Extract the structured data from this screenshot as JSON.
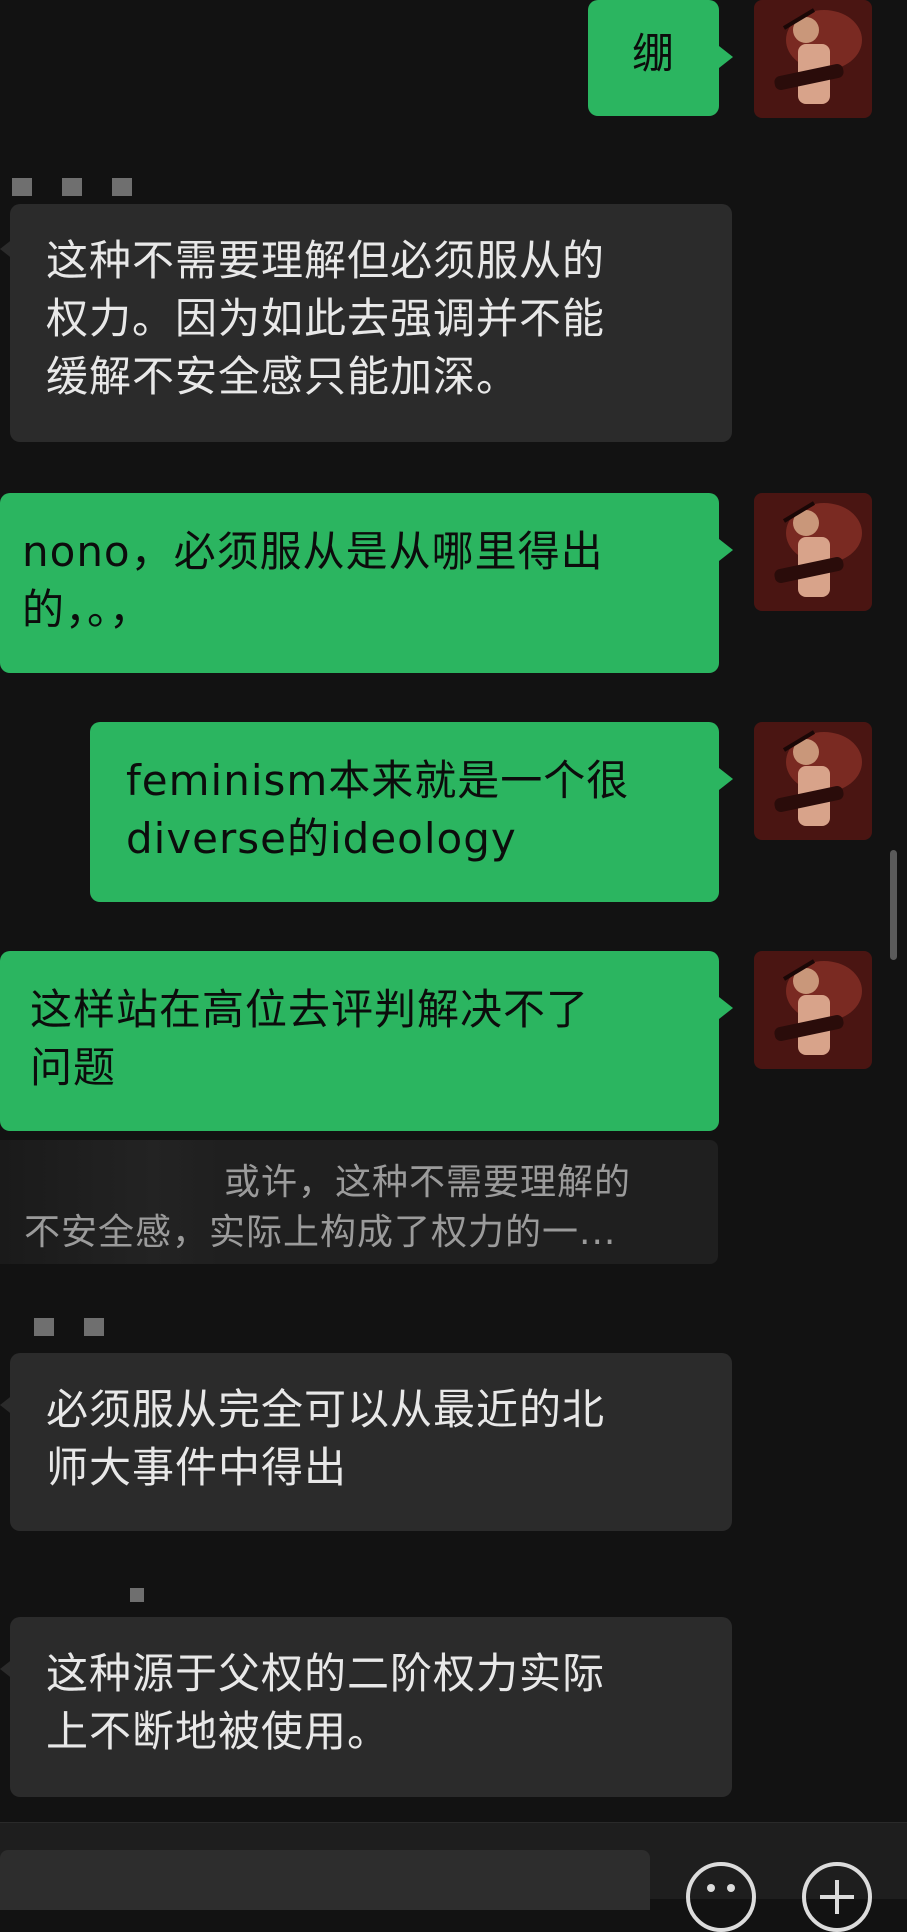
{
  "messages": [
    {
      "id": "m1",
      "side": "out",
      "text": "绷"
    },
    {
      "id": "m2",
      "side": "in",
      "text": "这种不需要理解但必须服从的\n权力。因为如此去强调并不能\n缓解不安全感只能加深。"
    },
    {
      "id": "m3",
      "side": "out",
      "text": "nono，必须服从是从哪里得出\n的，。，"
    },
    {
      "id": "m4",
      "side": "out",
      "text": "feminism本来就是一个很\ndiverse的ideology"
    },
    {
      "id": "m5",
      "side": "out",
      "text": "这样站在高位去评判解决不了\n问题"
    },
    {
      "id": "m6",
      "side": "in",
      "text": "必须服从完全可以从最近的北\n师大事件中得出"
    },
    {
      "id": "m7",
      "side": "in",
      "text": "这种源于父权的二阶权力实际\n上不断地被使用。"
    }
  ],
  "quote": {
    "line1": "或许，这种不需要理解的",
    "line2": "不安全感，实际上构成了权力的一..."
  },
  "colors": {
    "outgoing_bubble": "#2bb560",
    "incoming_bubble": "#2b2b2b",
    "background": "#121212"
  },
  "icons": {
    "emoji": "emoji-icon",
    "plus": "plus-icon"
  }
}
